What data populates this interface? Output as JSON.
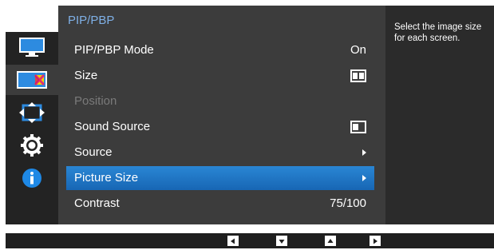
{
  "sidebar": {
    "items": [
      {
        "icon": "picture-icon"
      },
      {
        "icon": "color-icon"
      },
      {
        "icon": "size-position-icon"
      },
      {
        "icon": "settings-gear-icon"
      },
      {
        "icon": "information-icon"
      }
    ]
  },
  "menu": {
    "title": "PIP/PBP",
    "items": [
      {
        "label": "PIP/PBP Mode",
        "value": "On"
      },
      {
        "label": "Size",
        "value_icon": "pbp-split-icon"
      },
      {
        "label": "Position",
        "disabled": true
      },
      {
        "label": "Sound Source",
        "value_icon": "pip-left-window-icon"
      },
      {
        "label": "Source",
        "value_icon": "submenu-arrow-icon"
      },
      {
        "label": "Picture Size",
        "selected": true,
        "value_icon": "submenu-arrow-icon"
      },
      {
        "label": "Contrast",
        "value": "75/100"
      }
    ]
  },
  "help": {
    "text": "Select the image size for each screen."
  },
  "bottom_bar": {
    "buttons": [
      "left-arrow-button",
      "down-arrow-button",
      "up-arrow-button",
      "right-arrow-button"
    ]
  },
  "colors": {
    "selected": "#1f77c8",
    "title": "#7fb0e6",
    "panel": "#3c3c3c",
    "sidebar": "#232323"
  }
}
